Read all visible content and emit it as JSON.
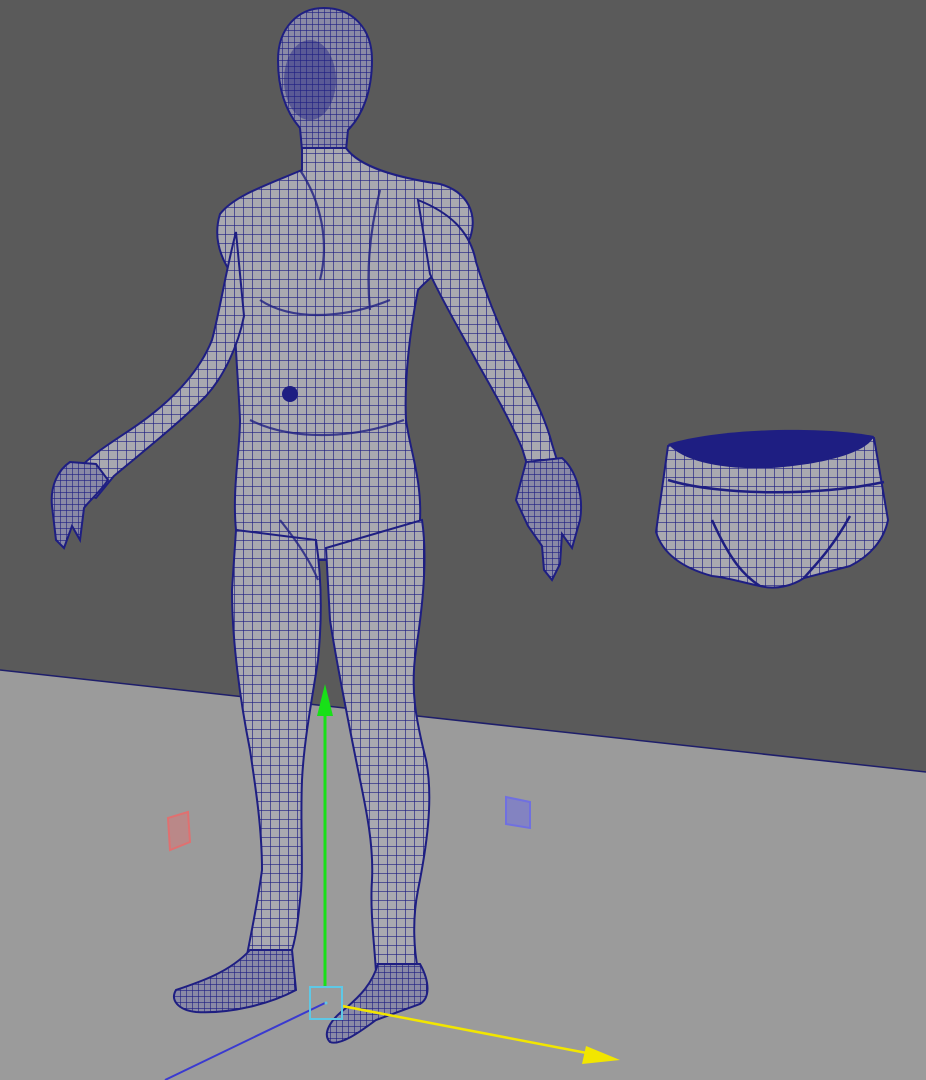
{
  "viewport": {
    "background_color": "#5a5a5a",
    "ground_color": "#9b9b9b",
    "wire_color": "#1e1e82",
    "mesh_fill": "#a9a9b0",
    "objects": [
      "human-body-mesh",
      "briefs-mesh"
    ]
  },
  "manipulator": {
    "type": "move-tool",
    "y_axis_color": "#18e018",
    "x_axis_color": "#f2e600",
    "z_axis_color": "#3a3ad0",
    "center_handle_color": "#5ec8e6",
    "x_plane_handle_color": "#e07070",
    "z_plane_handle_color": "#7070e0"
  }
}
